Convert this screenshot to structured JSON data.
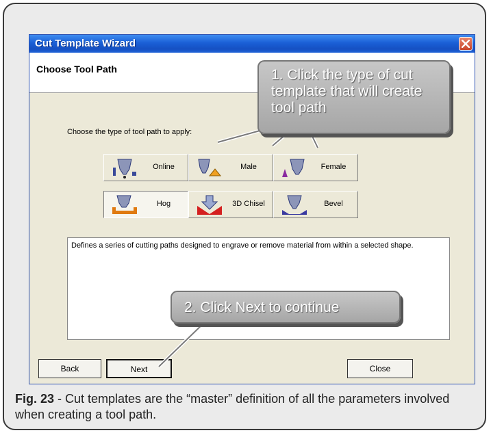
{
  "window": {
    "title": "Cut Template Wizard",
    "header": "Choose Tool Path",
    "instruction": "Choose the type of tool path to apply:",
    "description": "Defines a series of cutting paths designed to engrave or remove material from within a selected shape."
  },
  "tool_buttons": [
    {
      "label": "Online",
      "icon": "online-tool-icon",
      "selected": false
    },
    {
      "label": "Male",
      "icon": "male-tool-icon",
      "selected": false
    },
    {
      "label": "Female",
      "icon": "female-tool-icon",
      "selected": false
    },
    {
      "label": "Hog",
      "icon": "hog-tool-icon",
      "selected": true
    },
    {
      "label": "3D Chisel",
      "icon": "chisel-tool-icon",
      "selected": false
    },
    {
      "label": "Bevel",
      "icon": "bevel-tool-icon",
      "selected": false
    }
  ],
  "buttons": {
    "back": "Back",
    "next": "Next",
    "close": "Close"
  },
  "callouts": {
    "step1": "1. Click the type of cut template that will create tool path",
    "step2": "2. Click Next to continue"
  },
  "caption": {
    "label": "Fig. 23",
    "text": " - Cut templates are the “master” definition of all the parameters involved when creating a tool path."
  },
  "colors": {
    "titlebar": "#1a5fd6",
    "window_bg": "#ece9d8",
    "callout": "#b5b5b5",
    "close_button": "#c9452a"
  }
}
